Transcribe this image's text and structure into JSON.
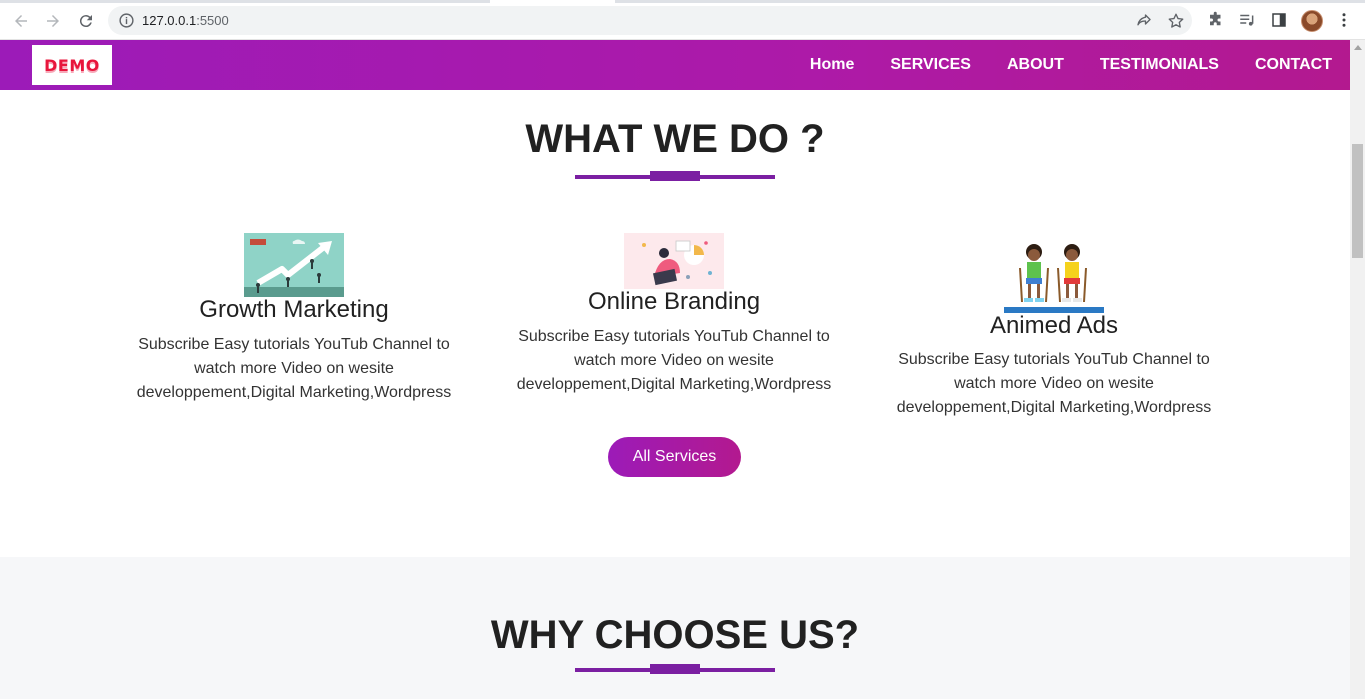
{
  "browser": {
    "url_host": "127.0.0.1",
    "url_port": ":5500"
  },
  "navbar": {
    "logo_text": "DEMO",
    "links": [
      "Home",
      "SERVICES",
      "ABOUT",
      "TESTIMONIALS",
      "CONTACT"
    ]
  },
  "what_we_do": {
    "title": "WHAT WE DO ?",
    "services": [
      {
        "title": "Growth Marketing",
        "text": "Subscribe Easy tutorials YouTub Channel to watch more Video on wesite developpement,Digital Marketing,Wordpress",
        "image_icon": "growth-chart-illustration"
      },
      {
        "title": "Online Branding",
        "text": "Subscribe Easy tutorials YouTub Channel to watch more Video on wesite developpement,Digital Marketing,Wordpress",
        "image_icon": "branding-illustration"
      },
      {
        "title": "Animed Ads",
        "text": "Subscribe Easy tutorials YouTub Channel to watch more Video on wesite developpement,Digital Marketing,Wordpress",
        "image_icon": "animated-kids-illustration"
      }
    ],
    "button_label": "All Services"
  },
  "why_choose": {
    "title": "WHY CHOOSE US?"
  },
  "colors": {
    "brand_purple": "#9c1bb8",
    "brand_magenta": "#b3198f",
    "underline": "#7b1fa2",
    "logo_red": "#e8163c"
  }
}
